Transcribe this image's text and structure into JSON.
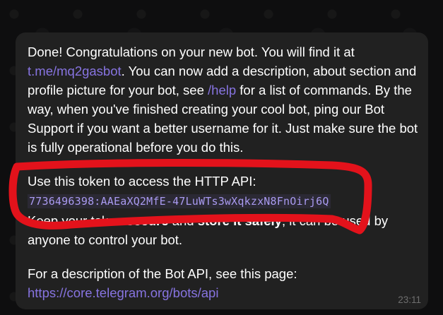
{
  "message": {
    "p1_before_link1": "Done! Congratulations on your new bot. You will find it at ",
    "p1_link1": "t.me/mq2gasbot",
    "p1_between_links": ". You can now add a description, about section and profile picture for your bot, see ",
    "p1_link2": "/help",
    "p1_after_link2": " for a list of commands. By the way, when you've finished creating your cool bot, ping our Bot Support if you want a better username for it. Just make sure the bot is fully operational before you do this.",
    "token_intro": "Use this token to access the HTTP API:",
    "token": "7736496398:AAEaXQ2MfE-47LuWTs3wXqkzxN8FnOirj6Q",
    "p3_before_bold1": "Keep your token ",
    "p3_bold1": "secure",
    "p3_middle": " and ",
    "p3_bold2": "store it safely",
    "p3_after": ", it can be used by anyone to control your bot.",
    "p4_before_link": "For a description of the Bot API, see this page: ",
    "p4_link": "https://core.telegram.org/bots/api",
    "time": "23:11"
  },
  "colors": {
    "background": "#0e0e0f",
    "bubble": "#212121",
    "link": "#8774e1",
    "annotation": "#e3121b"
  }
}
